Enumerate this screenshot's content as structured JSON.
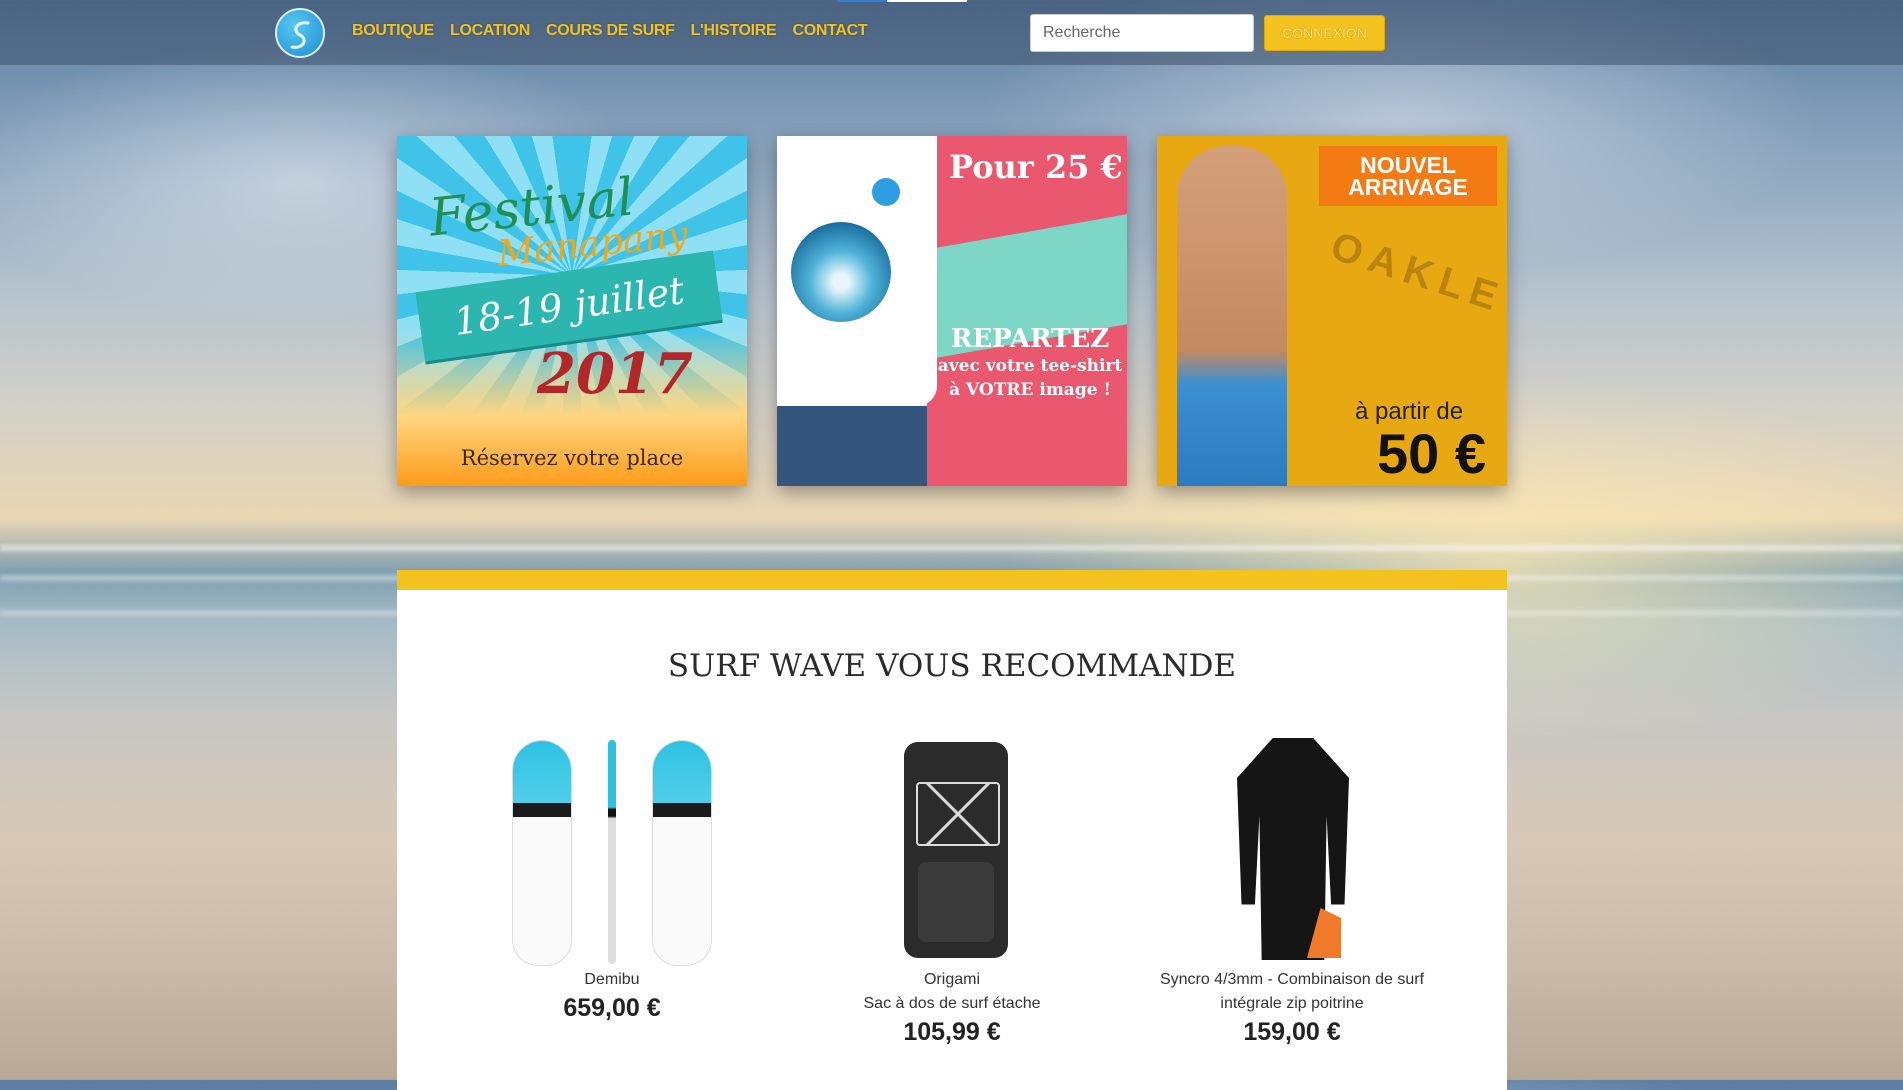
{
  "nav": {
    "items": [
      "BOUTIQUE",
      "LOCATION",
      "COURS DE SURF",
      "L'HISTOIRE",
      "CONTACT"
    ],
    "search_placeholder": "Recherche",
    "login_label": "CONNEXION"
  },
  "banners": {
    "festival": {
      "title": "Festival",
      "subtitle": "Manapany",
      "dates": "18-19 juillet",
      "year": "2017",
      "cta": "Réservez votre place"
    },
    "tshirt": {
      "price": "Pour 25 €",
      "headline": "REPARTEZ",
      "line1": "avec votre tee-shirt",
      "line2": "à VOTRE image !"
    },
    "arrival": {
      "tag_line1": "NOUVEL",
      "tag_line2": "ARRIVAGE",
      "brand": "OAKLEY",
      "from": "à partir de",
      "price": "50 €"
    }
  },
  "recommend": {
    "title": "SURF WAVE VOUS RECOMMANDE",
    "products": [
      {
        "name": "Demibu",
        "subtitle": "",
        "price": "659,00 €"
      },
      {
        "name": "Origami",
        "subtitle": "Sac à dos de surf étache",
        "price": "105,99 €"
      },
      {
        "name": "Syncro 4/3mm - Combinaison de surf",
        "subtitle": "intégrale zip poitrine",
        "price": "159,00 €"
      }
    ]
  },
  "colors": {
    "accent": "#f4c21f",
    "brand_blue": "#2f9ee0"
  }
}
